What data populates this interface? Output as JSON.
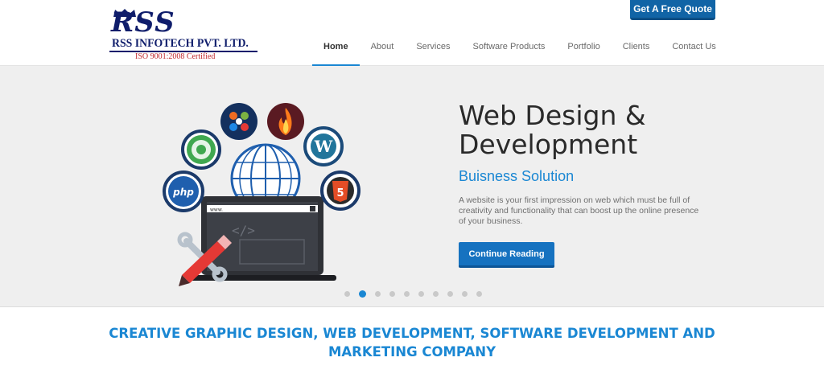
{
  "logo": {
    "mark": "RSS",
    "company": "RSS INFOTECH PVT. LTD.",
    "certification": "ISO 9001:2008 Certified"
  },
  "header": {
    "quote_label": "Get A Free Quote"
  },
  "nav": {
    "items": [
      {
        "label": "Home",
        "active": true
      },
      {
        "label": "About",
        "active": false
      },
      {
        "label": "Services",
        "active": false
      },
      {
        "label": "Software Products",
        "active": false
      },
      {
        "label": "Portfolio",
        "active": false
      },
      {
        "label": "Clients",
        "active": false
      },
      {
        "label": "Contact Us",
        "active": false
      }
    ]
  },
  "hero": {
    "title": "Web Design & Development",
    "subtitle": "Buisness Solution",
    "text": "A website is your first impression on web which must be full of creativity and functionality that can boost up the online presence of your business.",
    "cta_label": "Continue Reading",
    "illustration": {
      "url_text": "www.",
      "php_label": "php",
      "html5_label": "5",
      "icons": [
        "opensource-icon",
        "joomla-icon",
        "codeigniter-icon",
        "wordpress-icon",
        "php-icon",
        "html5-icon",
        "globe-icon",
        "laptop-icon",
        "wrench-icon",
        "pencil-icon"
      ]
    },
    "slider": {
      "count": 10,
      "active_index": 1
    }
  },
  "tagline": "CREATIVE GRAPHIC DESIGN, WEB DEVELOPMENT, SOFTWARE DEVELOPMENT AND MARKETING COMPANY",
  "colors": {
    "brand_blue": "#1a87d3",
    "button_blue": "#1672c0",
    "logo_navy": "#0f1d6b",
    "logo_red": "#c0282d"
  }
}
